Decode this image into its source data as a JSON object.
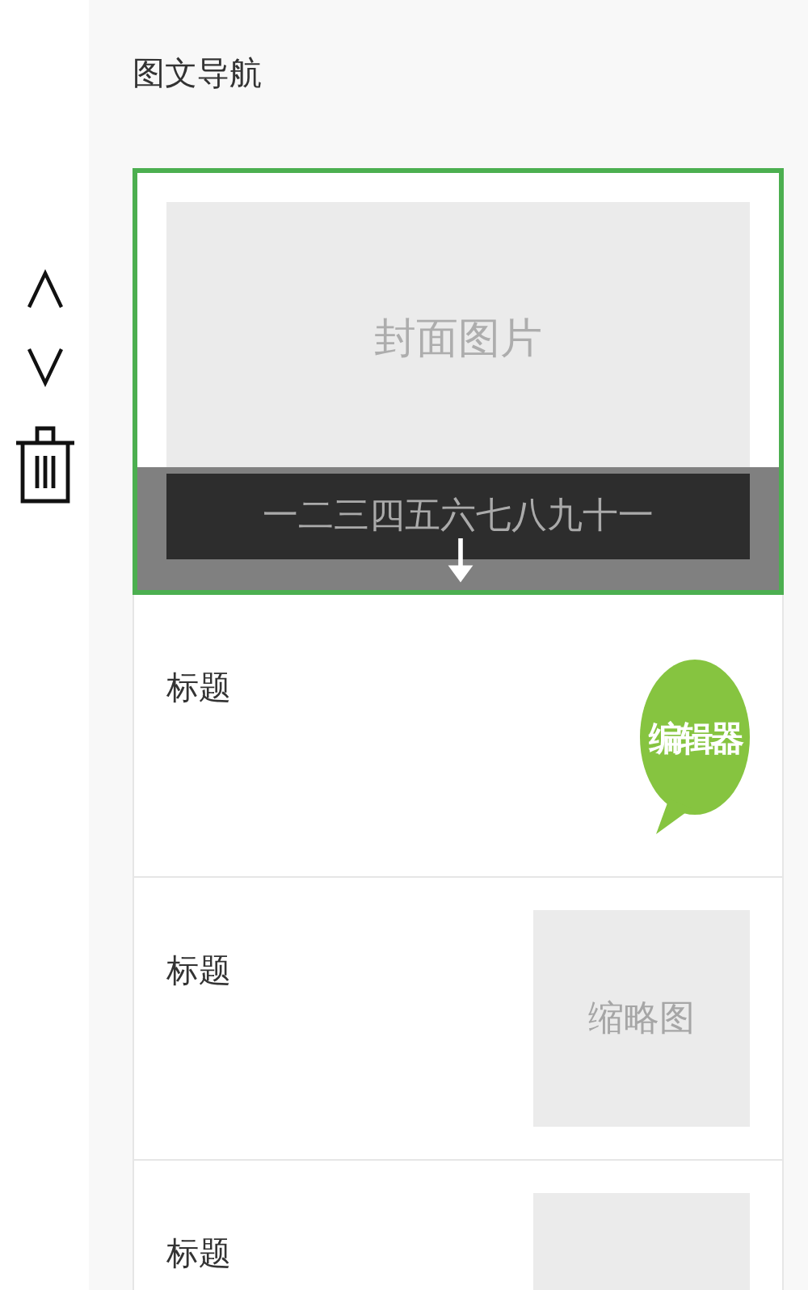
{
  "side_controls": [
    {
      "kind": "up"
    },
    {
      "kind": "down"
    },
    {
      "kind": "delete"
    }
  ],
  "panel": {
    "title": "图文导航"
  },
  "items": [
    {
      "kind": "cover",
      "selected": true,
      "image_label": "封面图片",
      "caption": "一二三四五六七八九十一"
    },
    {
      "kind": "editor",
      "selected": false,
      "title": "标题",
      "badge": "编辑器"
    },
    {
      "kind": "thumb",
      "selected": false,
      "title": "标题",
      "thumb_label": "缩略图"
    },
    {
      "kind": "thumb",
      "selected": false,
      "title": "标题"
    }
  ]
}
